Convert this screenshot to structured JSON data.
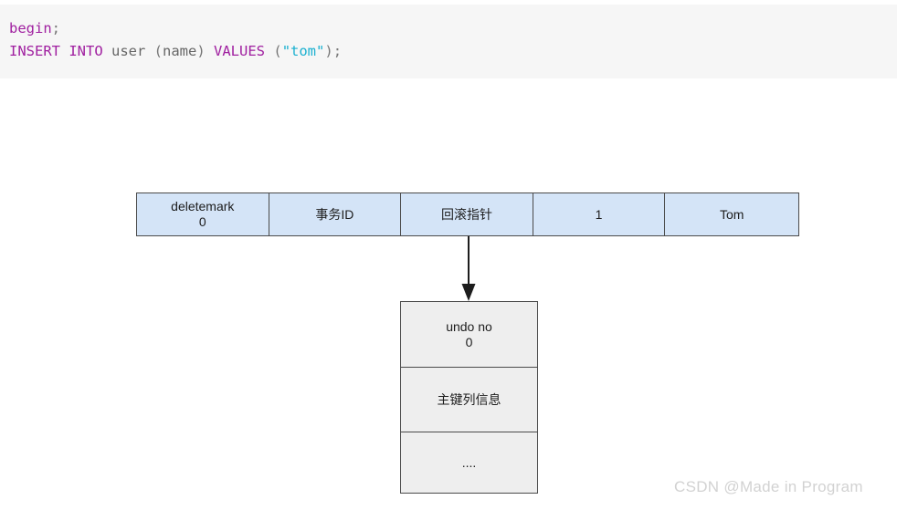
{
  "code_block": {
    "line1": [
      {
        "text": "begin",
        "type": "kw"
      },
      {
        "text": ";",
        "type": "punc"
      }
    ],
    "line2": [
      {
        "text": "INSERT",
        "type": "kw"
      },
      {
        "text": " ",
        "type": "punc"
      },
      {
        "text": "INTO",
        "type": "kw"
      },
      {
        "text": " ",
        "type": "punc"
      },
      {
        "text": "user",
        "type": "id"
      },
      {
        "text": " (",
        "type": "punc"
      },
      {
        "text": "name",
        "type": "id"
      },
      {
        "text": ") ",
        "type": "punc"
      },
      {
        "text": "VALUES",
        "type": "kw"
      },
      {
        "text": " (",
        "type": "punc"
      },
      {
        "text": "\"tom\"",
        "type": "str"
      },
      {
        "text": ");",
        "type": "punc"
      }
    ]
  },
  "record_row": {
    "cells": [
      {
        "label": "deletemark",
        "value": "0"
      },
      {
        "label": "事务ID",
        "value": ""
      },
      {
        "label": "回滚指针",
        "value": ""
      },
      {
        "label": "1",
        "value": ""
      },
      {
        "label": "Tom",
        "value": ""
      }
    ]
  },
  "undo_log": {
    "cells": [
      {
        "label": "undo no",
        "value": "0"
      },
      {
        "label": "主键列信息",
        "value": ""
      },
      {
        "label": "....",
        "value": ""
      }
    ]
  },
  "watermark": {
    "text": "CSDN @Made in Program"
  },
  "colors": {
    "code_background": "#f6f6f6",
    "keyword": "#a020a0",
    "string": "#1ab0d0",
    "identifier": "#666666",
    "punctuation": "#777777",
    "record_cell_fill": "#d4e4f7",
    "undo_cell_fill": "#eeeeee",
    "border": "#4a4a4a",
    "watermark": "#d2d2d2"
  }
}
